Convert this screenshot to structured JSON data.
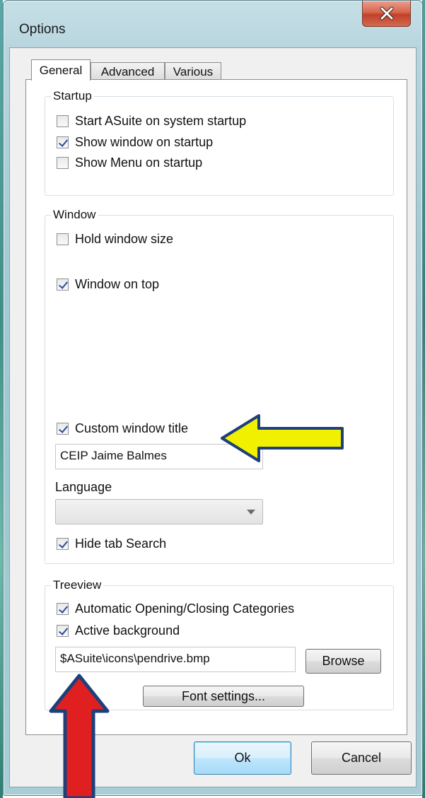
{
  "window": {
    "title": "Options",
    "close_glyph": "X"
  },
  "tabs": [
    {
      "label": "General",
      "active": true
    },
    {
      "label": "Advanced",
      "active": false
    },
    {
      "label": "Various",
      "active": false
    }
  ],
  "startup": {
    "legend": "Startup",
    "options": [
      {
        "label": "Start ASuite on system startup",
        "checked": false
      },
      {
        "label": "Show window on startup",
        "checked": true
      },
      {
        "label": "Show Menu on startup",
        "checked": false
      }
    ]
  },
  "window_group": {
    "legend": "Window",
    "hold_size": {
      "label": "Hold window size",
      "checked": false
    },
    "on_top": {
      "label": "Window on top",
      "checked": true
    },
    "custom_title": {
      "label": "Custom window title",
      "checked": true
    },
    "custom_title_value": "CEIP Jaime Balmes",
    "language_label": "Language",
    "language_value": "",
    "hide_search": {
      "label": "Hide tab Search",
      "checked": true
    }
  },
  "treeview": {
    "legend": "Treeview",
    "auto_open": {
      "label": "Automatic Opening/Closing Categories",
      "checked": true
    },
    "active_bg": {
      "label": "Active background",
      "checked": true
    },
    "background_path": "$ASuite\\icons\\pendrive.bmp",
    "browse_label": "Browse",
    "font_settings_label": "Font settings..."
  },
  "footer": {
    "ok_label": "Ok",
    "cancel_label": "Cancel"
  },
  "annotations": {
    "yellow_arrow_color": "#f0f000",
    "red_arrow_color": "#e02020",
    "arrow_outline_color": "#1e3f7a"
  }
}
